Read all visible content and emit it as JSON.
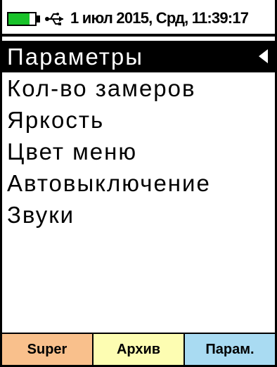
{
  "status": {
    "battery_level": 0.8,
    "battery_color": "#19c22a",
    "usb_icon": "usb-connected-icon",
    "datetime": "1 июл 2015, Срд, 11:39:17"
  },
  "menu": {
    "items": [
      {
        "label": "Параметры",
        "selected": true
      },
      {
        "label": "Кол-во замеров",
        "selected": false
      },
      {
        "label": "Яркость",
        "selected": false
      },
      {
        "label": "Цвет меню",
        "selected": false
      },
      {
        "label": "Автовыключение",
        "selected": false
      },
      {
        "label": "Звуки",
        "selected": false
      }
    ]
  },
  "softkeys": [
    {
      "label": "Super",
      "color": "#f9c08c"
    },
    {
      "label": "Архив",
      "color": "#fdfdb2"
    },
    {
      "label": "Парам.",
      "color": "#a9dbf2"
    }
  ]
}
